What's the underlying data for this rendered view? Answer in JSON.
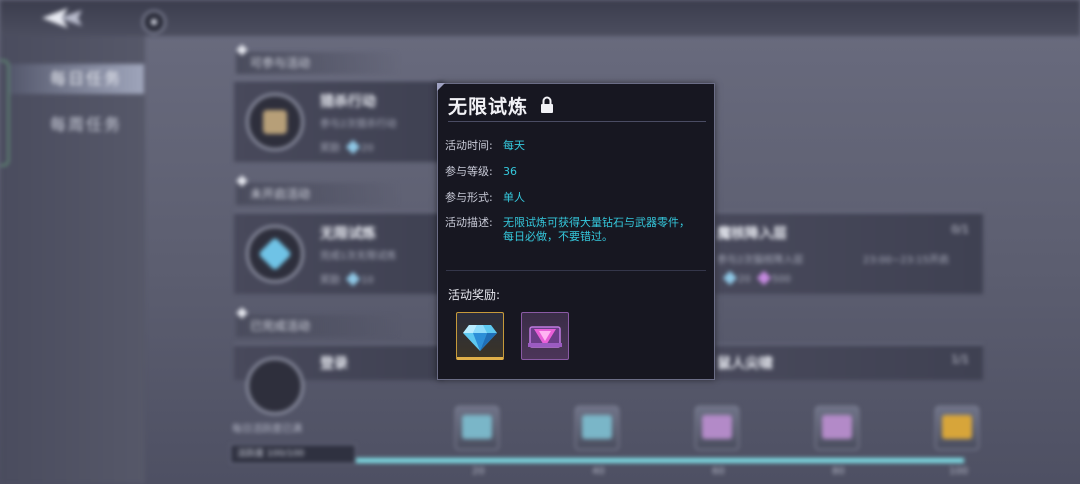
{
  "sidebar": {
    "tabs": [
      {
        "label": "每日任务",
        "active": true
      },
      {
        "label": "每周任务",
        "active": false
      }
    ]
  },
  "sections": [
    {
      "title": "可参与活动"
    },
    {
      "title": "未开启活动"
    },
    {
      "title": "已完成活动"
    }
  ],
  "cards": [
    {
      "title": "猎杀行动",
      "subtitle": "参与2次猎杀行动",
      "reward_label": "奖励",
      "reward_amount": "20"
    },
    {
      "title": "无限试炼",
      "subtitle": "完成1次无限试炼",
      "reward_label": "奖励",
      "reward_amount": "10"
    },
    {
      "title": "登录",
      "subtitle": "",
      "reward_label": "",
      "reward_amount": ""
    },
    {
      "title": "魔核降入层",
      "subtitle": "参与2次猫核降入层",
      "reward_label": "",
      "reward_amount": "20",
      "reward_amount_2": "500",
      "count": "0/1",
      "time": "23:00~23:15开启"
    },
    {
      "title": "鼠人尖啸",
      "count": "1/1"
    }
  ],
  "progress": {
    "label": "每日活跃度已满",
    "box_label": "活跃度",
    "box_value": "100/100",
    "fraction": 1.0,
    "ticks": [
      "20",
      "40",
      "60",
      "80",
      "100"
    ]
  },
  "popup": {
    "title": "无限试炼",
    "rows": [
      {
        "label": "活动时间:",
        "value": "每天"
      },
      {
        "label": "参与等级:",
        "value": "36"
      },
      {
        "label": "参与形式:",
        "value": "单人"
      },
      {
        "label": "活动描述:",
        "value": "无限试炼可获得大量钻石与武器零件，每日必做，不要错过。"
      }
    ],
    "reward_title": "活动奖励:",
    "rewards": [
      {
        "icon": "diamond-icon",
        "rarity_color": "#e0b04a"
      },
      {
        "icon": "weapon-part-icon",
        "rarity_color": "#8a5aa4"
      }
    ]
  },
  "colors": {
    "accent": "#35c9dd",
    "popup_bg": "#171721"
  }
}
